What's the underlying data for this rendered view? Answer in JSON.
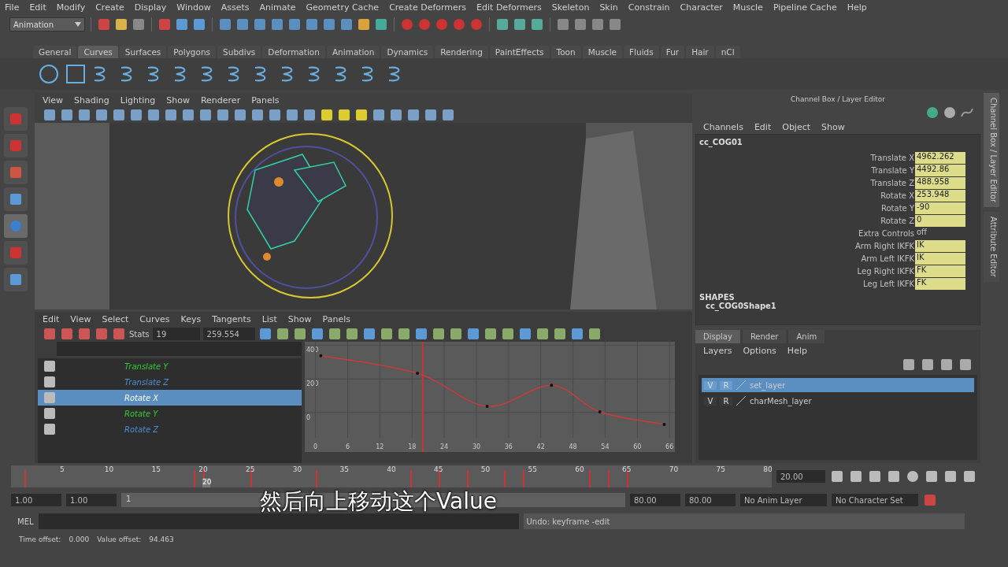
{
  "menu_bar": [
    "File",
    "Edit",
    "Modify",
    "Create",
    "Display",
    "Window",
    "Assets",
    "Animate",
    "Geometry Cache",
    "Create Deformers",
    "Edit Deformers",
    "Skeleton",
    "Skin",
    "Constrain",
    "Character",
    "Muscle",
    "Pipeline Cache",
    "Help"
  ],
  "mode_menu": {
    "value": "Animation"
  },
  "shelf": {
    "tabs": [
      {
        "label": "General",
        "selected": false
      },
      {
        "label": "Curves",
        "selected": true
      },
      {
        "label": "Surfaces",
        "selected": false
      },
      {
        "label": "Polygons",
        "selected": false
      },
      {
        "label": "Subdivs",
        "selected": false
      },
      {
        "label": "Deformation",
        "selected": false
      },
      {
        "label": "Animation",
        "selected": false
      },
      {
        "label": "Dynamics",
        "selected": false
      },
      {
        "label": "Rendering",
        "selected": false
      },
      {
        "label": "PaintEffects",
        "selected": false
      },
      {
        "label": "Toon",
        "selected": false
      },
      {
        "label": "Muscle",
        "selected": false
      },
      {
        "label": "Fluids",
        "selected": false
      },
      {
        "label": "Fur",
        "selected": false
      },
      {
        "label": "Hair",
        "selected": false
      },
      {
        "label": "nCl",
        "selected": false
      }
    ]
  },
  "viewport": {
    "menu": [
      "View",
      "Shading",
      "Lighting",
      "Show",
      "Renderer",
      "Panels"
    ]
  },
  "graph_editor": {
    "menu": [
      "Edit",
      "View",
      "Select",
      "Curves",
      "Keys",
      "Tangents",
      "List",
      "Show",
      "Panels"
    ],
    "stats_label": "Stats",
    "stats_frame": "19",
    "stats_value": "259.554",
    "channels": [
      {
        "name": "Translate Y",
        "color": "#33cc33",
        "selected": false
      },
      {
        "name": "Translate Z",
        "color": "#4a8fd8",
        "selected": false
      },
      {
        "name": "Rotate X",
        "color": "#ffffff",
        "selected": true
      },
      {
        "name": "Rotate Y",
        "color": "#33cc33",
        "selected": false
      },
      {
        "name": "Rotate Z",
        "color": "#4a8fd8",
        "selected": false
      }
    ],
    "chart_data": {
      "type": "line",
      "grid": true,
      "ref_lines": [
        {
          "axis": "x",
          "value": 20,
          "color": "#cc3333"
        }
      ],
      "x": [
        1,
        19,
        32,
        44,
        53,
        65
      ],
      "values": [
        337,
        233,
        37,
        162,
        4,
        -70
      ],
      "xlim": [
        -2,
        67
      ],
      "ylim": [
        -150,
        420
      ],
      "xticks": [
        {
          "value": 0,
          "label": "0"
        },
        6,
        12,
        18,
        24,
        30,
        36,
        42,
        48,
        54,
        60,
        66
      ],
      "yticks": [
        0,
        200,
        400
      ]
    }
  },
  "channel_box": {
    "title": "Channel Box / Layer Editor",
    "menu": [
      "Channels",
      "Edit",
      "Object",
      "Show"
    ],
    "object": "cc_COG01",
    "attributes": [
      {
        "kind": "field",
        "name": "Translate X",
        "value": "4962.262"
      },
      {
        "kind": "field",
        "name": "Translate Y",
        "value": "4492.86"
      },
      {
        "kind": "field",
        "name": "Translate Z",
        "value": "488.958"
      },
      {
        "kind": "field",
        "name": "Rotate X",
        "value": "253.948"
      },
      {
        "kind": "field",
        "name": "Rotate Y",
        "value": "-90"
      },
      {
        "kind": "field",
        "name": "Rotate Z",
        "value": "0"
      },
      {
        "kind": "plain",
        "name": "Extra Controls",
        "value": "off"
      },
      {
        "kind": "field",
        "name": "Arm Right IKFK",
        "value": "IK"
      },
      {
        "kind": "field",
        "name": "Arm Left IKFK",
        "value": "IK"
      },
      {
        "kind": "field",
        "name": "Leg Right IKFK",
        "value": "FK"
      },
      {
        "kind": "field",
        "name": "Leg Left IKFK",
        "value": "FK"
      }
    ],
    "shapes_heading": "SHAPES",
    "shape": "cc_COG0Shape1"
  },
  "layer_editor": {
    "tabs": [
      {
        "label": "Display",
        "selected": true
      },
      {
        "label": "Render",
        "selected": false
      },
      {
        "label": "Anim",
        "selected": false
      }
    ],
    "menu": [
      "Layers",
      "Options",
      "Help"
    ],
    "layers": [
      {
        "visible": "V",
        "render": "R",
        "name": "set_layer",
        "selected": true
      },
      {
        "visible": "V",
        "render": "R",
        "name": "charMesh_layer",
        "selected": false
      }
    ]
  },
  "side_tabs": [
    "Channel Box / Layer Editor",
    "Attribute Editor"
  ],
  "timeline": {
    "ticks": [
      "5",
      "10",
      "15",
      "20",
      "25",
      "30",
      "35",
      "40",
      "45",
      "50",
      "55",
      "60",
      "65",
      "70",
      "75",
      "80"
    ],
    "current": "20",
    "level": 0.25,
    "frame_field": "20.00"
  },
  "range": {
    "start": "1.00",
    "playback_start": "1.00",
    "slider_label": "1",
    "level": 1,
    "playback_end": "80.00",
    "end": "80.00",
    "anim_layer": "No Anim Layer",
    "character_set": "No Character Set"
  },
  "command_line": {
    "label": "MEL",
    "output": "Undo: keyframe -edit"
  },
  "help_line": {
    "time_label": "Time offset:",
    "time_value": "0.000",
    "value_label": "Value offset:",
    "value_value": "94.463"
  },
  "subtitle": "然后向上移动这个Value"
}
